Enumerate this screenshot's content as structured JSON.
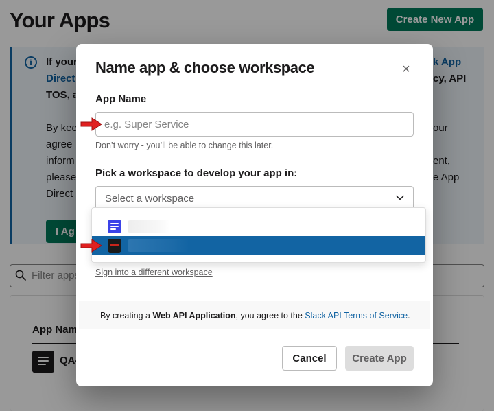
{
  "background": {
    "page_title": "Your Apps",
    "create_button": "Create New App",
    "banner": {
      "line1_left": "If your",
      "line1_right": "k App",
      "line2_left": "Direct",
      "line2_right": "cy, API",
      "line3_left": "TOS, a",
      "line4_left": "By kee",
      "line4_right": "our",
      "line5_left": "agree",
      "line6_left": "inform",
      "line6_right": "ent,",
      "line7_left": "please",
      "line7_right": "e App",
      "line8_left": "Direct",
      "agree_button": "I Ag"
    },
    "filter_placeholder": "Filter apps",
    "table_header": "App Nam",
    "app_name": "QA-"
  },
  "modal": {
    "title": "Name app & choose workspace",
    "close_icon": "×",
    "app_name_label": "App Name",
    "app_name_placeholder": "e.g. Super Service",
    "app_name_value": "",
    "app_name_hint": "Don’t worry - you’ll be able to change this later.",
    "workspace_label": "Pick a workspace to develop your app in:",
    "workspace_select_text": "Select a workspace",
    "workspace_options": [
      {
        "icon": "list-icon",
        "selected": false
      },
      {
        "icon": "dark-workspace-icon",
        "selected": true
      }
    ],
    "signin_link": "Sign into a different workspace",
    "terms": {
      "prefix": "By creating a ",
      "bold": "Web API Application",
      "middle": ", you agree to the ",
      "link": "Slack API Terms of Service",
      "suffix": "."
    },
    "cancel_button": "Cancel",
    "create_button": "Create App"
  },
  "colors": {
    "brand_green": "#007a5a",
    "link_blue": "#1264a3",
    "highlight_blue": "#1264a3",
    "arrow_red": "#e02020"
  }
}
